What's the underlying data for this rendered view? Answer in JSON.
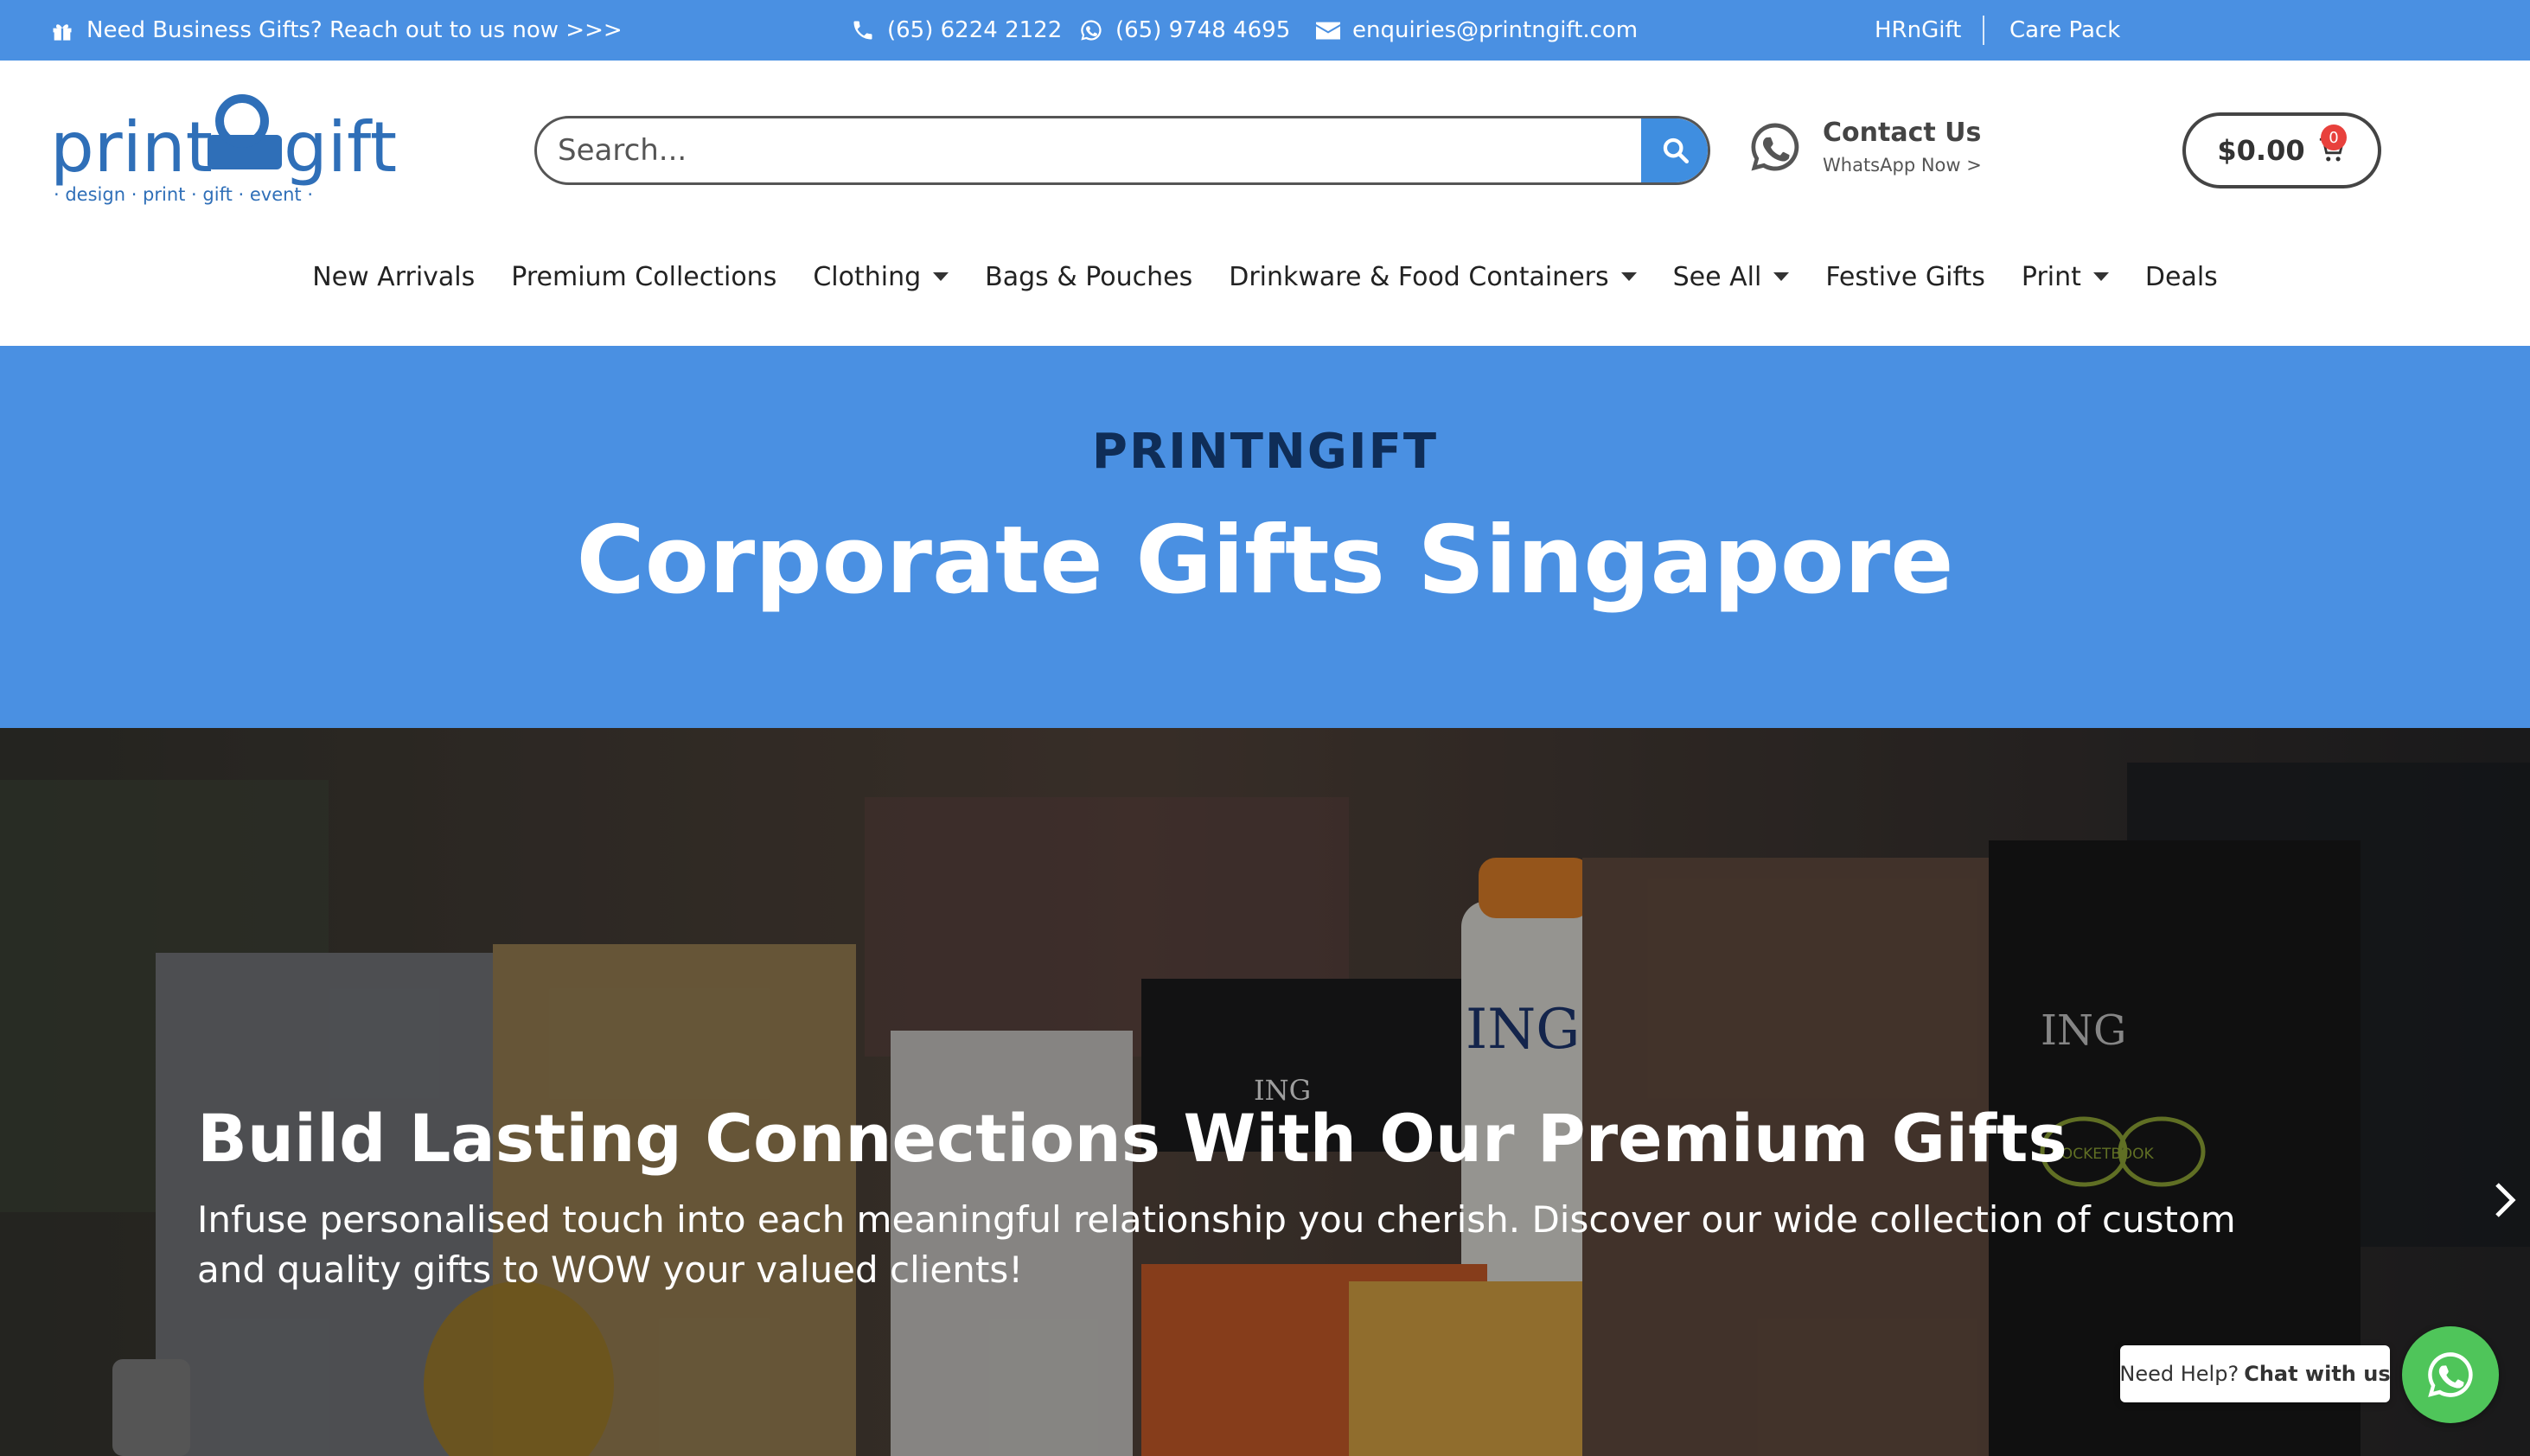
{
  "topbar": {
    "promo": "Need Business Gifts? Reach out to us now >>>",
    "phone": "(65) 6224 2122",
    "whatsapp": "(65) 9748 4695",
    "email": "enquiries@printngift.com",
    "links": [
      "HRnGift",
      "Care Pack"
    ]
  },
  "logo": {
    "text_left": "print",
    "text_right": "gift",
    "tagline": "· design · print · gift · event ·"
  },
  "search": {
    "placeholder": "Search..."
  },
  "contact": {
    "title": "Contact Us",
    "subtitle": "WhatsApp Now >"
  },
  "cart": {
    "amount": "$0.00",
    "count": "0"
  },
  "nav": [
    {
      "label": "New Arrivals",
      "dropdown": false
    },
    {
      "label": "Premium Collections",
      "dropdown": false
    },
    {
      "label": "Clothing",
      "dropdown": true
    },
    {
      "label": "Bags & Pouches",
      "dropdown": false
    },
    {
      "label": "Drinkware & Food Containers",
      "dropdown": true
    },
    {
      "label": "See All",
      "dropdown": true
    },
    {
      "label": "Festive Gifts",
      "dropdown": false
    },
    {
      "label": "Print",
      "dropdown": true
    },
    {
      "label": "Deals",
      "dropdown": false
    }
  ],
  "hero": {
    "brand": "PRINTNGIFT",
    "title": "Corporate Gifts Singapore"
  },
  "banner": {
    "headline": "Build Lasting Connections With Our Premium Gifts",
    "description": "Infuse personalised touch into each meaningful relationship you cherish. Discover our wide collection of custom and quality gifts to WOW your valued clients!",
    "photo_labels": [
      "ING",
      "ING",
      "ING",
      "ROCKETBOOK"
    ]
  },
  "chat": {
    "prefix": "Need Help?",
    "cta": "Chat with us"
  },
  "colors": {
    "brand_blue": "#4a90e2",
    "dark_navy": "#0f2d57",
    "whatsapp_green": "#4fc55a",
    "badge_red": "#e8413c"
  }
}
